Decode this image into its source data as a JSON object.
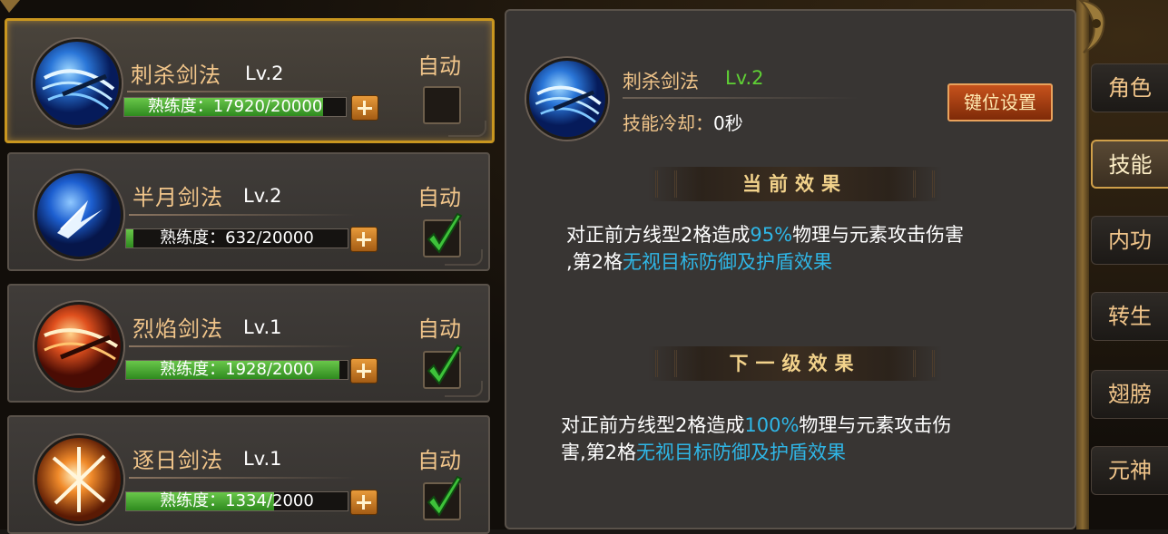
{
  "skills": [
    {
      "name": "刺杀剑法",
      "level": "Lv.2",
      "proficiency": "熟练度：17920/20000",
      "progress": 0.896,
      "auto_label": "自动",
      "auto_checked": false,
      "selected": true,
      "icon": "thrust-sword-icon"
    },
    {
      "name": "半月剑法",
      "level": "Lv.2",
      "proficiency": "熟练度：632/20000",
      "progress": 0.032,
      "auto_label": "自动",
      "auto_checked": true,
      "selected": false,
      "icon": "half-moon-sword-icon"
    },
    {
      "name": "烈焰剑法",
      "level": "Lv.1",
      "proficiency": "熟练度：1928/2000",
      "progress": 0.964,
      "auto_label": "自动",
      "auto_checked": true,
      "selected": false,
      "icon": "flame-sword-icon"
    },
    {
      "name": "逐日剑法",
      "level": "Lv.1",
      "proficiency": "熟练度：1334/2000",
      "progress": 0.667,
      "auto_label": "自动",
      "auto_checked": true,
      "selected": false,
      "icon": "sun-chase-sword-icon"
    }
  ],
  "detail": {
    "name": "刺杀剑法",
    "level": "Lv.2",
    "cooldown_label": "技能冷却：",
    "cooldown_value": "0秒",
    "keybind_button": "键位设置",
    "current_title": "当前效果",
    "current_desc_1": "对正前方线型2格造成",
    "current_pct": "95%",
    "current_desc_2": "物理与元素攻击伤害",
    "current_desc_3": ",第2格",
    "current_hl": "无视目标防御及护盾效果",
    "next_title": "下一级效果",
    "next_desc_1": "对正前方线型2格造成",
    "next_pct": "100%",
    "next_desc_2": "物理与元素攻击伤",
    "next_desc_3": "害,第2格",
    "next_hl": "无视目标防御及护盾效果"
  },
  "tabs": [
    {
      "label": "角色",
      "active": false
    },
    {
      "label": "技能",
      "active": true
    },
    {
      "label": "内功",
      "active": false
    },
    {
      "label": "转生",
      "active": false
    },
    {
      "label": "翅膀",
      "active": false
    },
    {
      "label": "元神",
      "active": false
    }
  ],
  "colors": {
    "accent_gold": "#f1c58a",
    "level_green": "#5fd035",
    "highlight_blue": "#2fb6e6",
    "selected_border": "#c9961f"
  }
}
